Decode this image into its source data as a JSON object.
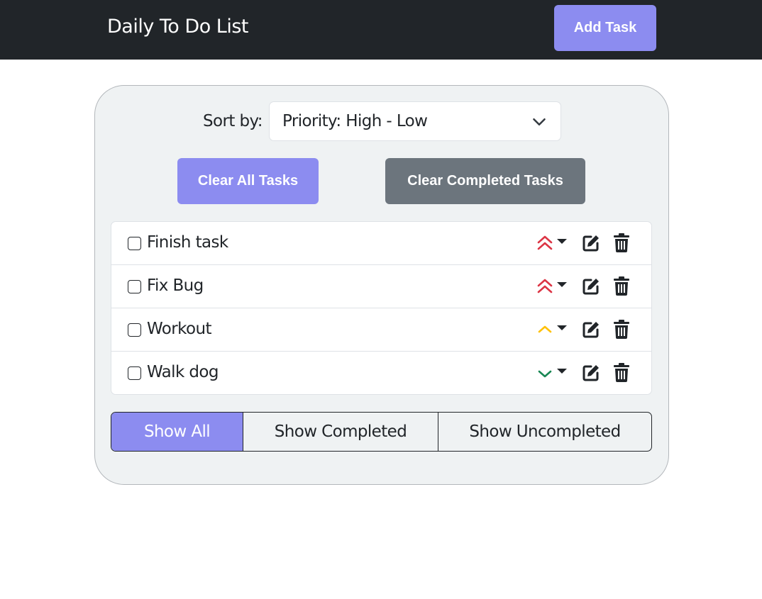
{
  "navbar": {
    "title": "Daily To Do List",
    "add_task_label": "Add Task"
  },
  "sort": {
    "label": "Sort by:",
    "selected": "Priority: High - Low"
  },
  "actions": {
    "clear_all_label": "Clear All Tasks",
    "clear_completed_label": "Clear Completed Tasks"
  },
  "tasks": [
    {
      "name": "Finish task",
      "completed": false,
      "priority": "highest",
      "priority_icon": "double-chevron-up-icon",
      "priority_color": "#dc3545"
    },
    {
      "name": "Fix Bug",
      "completed": false,
      "priority": "highest",
      "priority_icon": "double-chevron-up-icon",
      "priority_color": "#dc3545"
    },
    {
      "name": "Workout",
      "completed": false,
      "priority": "medium",
      "priority_icon": "chevron-up-icon",
      "priority_color": "#ffc107"
    },
    {
      "name": "Walk dog",
      "completed": false,
      "priority": "low",
      "priority_icon": "chevron-down-icon",
      "priority_color": "#198754"
    }
  ],
  "row_icons": {
    "edit": "edit-icon",
    "delete": "trash-icon",
    "priority_dropdown": "caret-down-icon"
  },
  "filters": [
    {
      "label": "Show All",
      "active": true
    },
    {
      "label": "Show Completed",
      "active": false
    },
    {
      "label": "Show Uncompleted",
      "active": false
    }
  ],
  "colors": {
    "accent": "#8c8cf0",
    "secondary": "#6c757d",
    "navbar": "#212529",
    "high": "#dc3545",
    "medium": "#ffc107",
    "low": "#198754"
  }
}
